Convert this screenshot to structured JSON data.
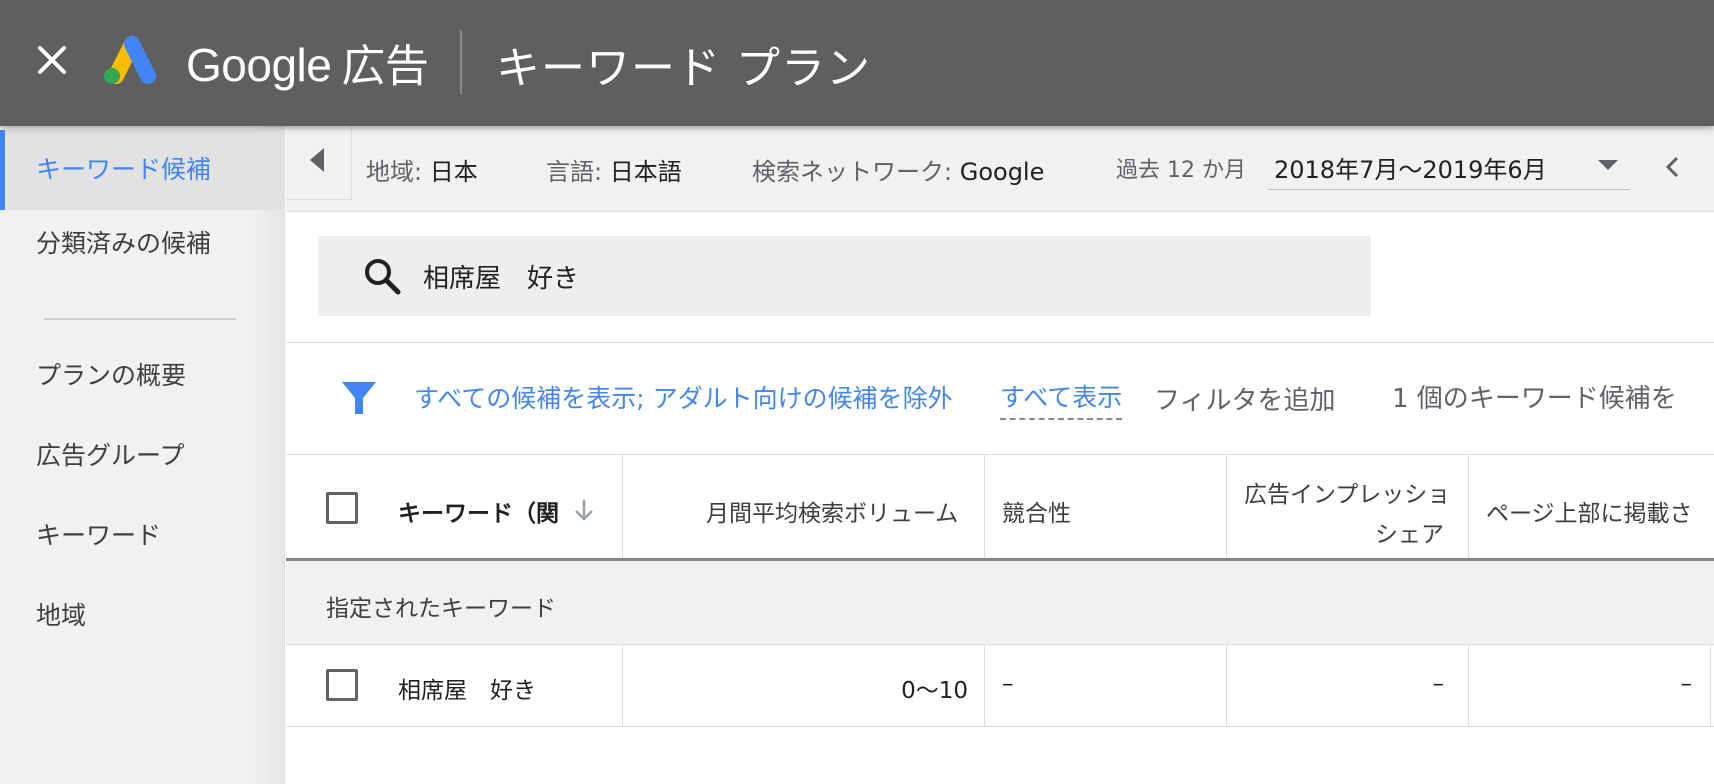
{
  "header": {
    "brand": "Google",
    "brand_suffix": "広告",
    "title": "キーワード プラン"
  },
  "sidebar": {
    "items": [
      {
        "label": "キーワード候補",
        "active": true
      },
      {
        "label": "分類済みの候補"
      },
      {
        "label": "プランの概要"
      },
      {
        "label": "広告グループ"
      },
      {
        "label": "キーワード"
      },
      {
        "label": "地域"
      }
    ]
  },
  "topbar": {
    "location_label": "地域:",
    "location_value": "日本",
    "language_label": "言語:",
    "language_value": "日本語",
    "network_label": "検索ネットワーク:",
    "network_value": "Google",
    "period_label": "過去 12 か月",
    "period_value": "2018年7月〜2019年6月"
  },
  "search": {
    "query": "相席屋　好き"
  },
  "filters": {
    "active_filter": "すべての候補を表示; アダルト向けの候補を除外",
    "show_all": "すべて表示",
    "add_filter": "フィルタを追加",
    "result_count": "1 個のキーワード候補を"
  },
  "table": {
    "headers": {
      "keyword": "キーワード（関",
      "volume": "月間平均検索ボリューム",
      "competition": "競合性",
      "impression_share_line1": "広告インプレッショ",
      "impression_share_line2": "シェア",
      "top_of_page": "ページ上部に掲載さ"
    },
    "group_label": "指定されたキーワード",
    "rows": [
      {
        "keyword": "相席屋　好き",
        "volume": "0〜10",
        "competition": "–",
        "impression_share": "–",
        "top_of_page": "–"
      }
    ]
  },
  "colors": {
    "header_bg": "#5f5f5f",
    "accent_blue": "#4285f4",
    "sidebar_bg": "#f1f1f1"
  },
  "icons": [
    "close-icon",
    "google-ads-logo",
    "triangle-left-icon",
    "chevron-down-icon",
    "chevron-left-icon",
    "search-icon",
    "filter-icon",
    "sort-arrow-icon"
  ]
}
